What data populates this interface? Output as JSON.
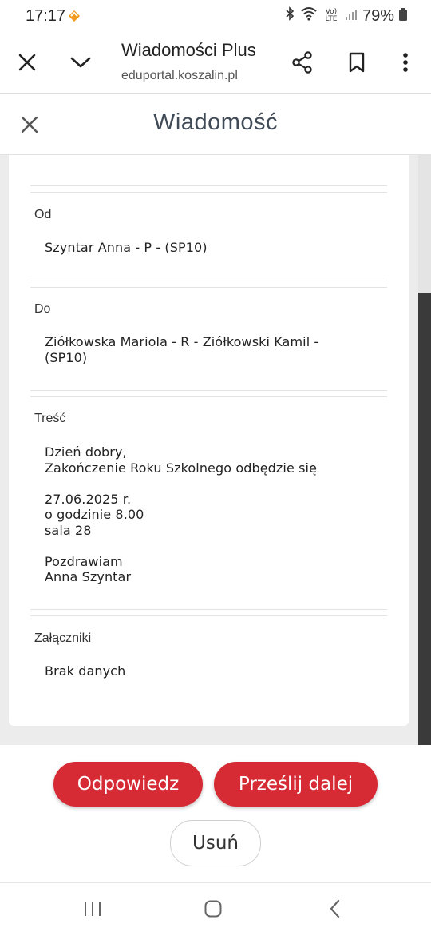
{
  "status_bar": {
    "time": "17:17",
    "battery": "79%",
    "network": "Vo) LTE"
  },
  "browser": {
    "title": "Wiadomości Plus",
    "url": "eduportal.koszalin.pl"
  },
  "modal": {
    "title": "Wiadomość"
  },
  "message": {
    "from_label": "Od",
    "from_value": "Szyntar Anna - P - (SP10)",
    "to_label": "Do",
    "to_value": "Ziółkowska Mariola - R - Ziółkowski Kamil -\n(SP10)",
    "body_label": "Treść",
    "body_value": "Dzień dobry,\nZakończenie Roku Szkolnego odbędzie się\n\n27.06.2025 r.\no godzinie 8.00\nsala 28\n\nPozdrawiam\nAnna Szyntar",
    "attachments_label": "Załączniki",
    "attachments_value": "Brak danych"
  },
  "actions": {
    "reply": "Odpowiedz",
    "forward": "Prześlij dalej",
    "delete": "Usuń"
  },
  "colors": {
    "primary_red": "#d62b35",
    "title_gray": "#3f4a56"
  }
}
